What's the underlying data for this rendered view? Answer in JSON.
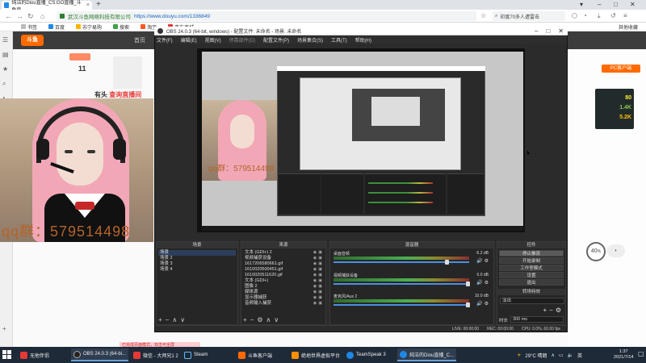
{
  "browser": {
    "tab_title": "纯洁的Diou直播_CS:GO直播_斗鱼直",
    "address_cert": "武汉斗鱼网络科技有限公司",
    "url": "https://www.douyu.com/1336849",
    "search_text": "印度70多人遭雷击",
    "bookmarks": [
      "书签",
      "百度",
      "苏宁易购",
      "搜索",
      "淘宝",
      "京东商城"
    ],
    "bookmarks_right": "其他收藏"
  },
  "douyu": {
    "logo_text": "斗鱼",
    "home_label": "首页",
    "sidebar_count": "11",
    "anchor_line_prefix": "有头",
    "anchor_line_text": "查询直播间",
    "right_label": "PC客户端",
    "gauge_value": "40",
    "gauge_unit": "%",
    "net_stats": [
      "80",
      "1.4K",
      "5.2K"
    ],
    "hint": "已完成页面模式，双击可全屏"
  },
  "webcam": {
    "qq_text": "qq群：579514498"
  },
  "obs": {
    "title": "OBS 24.0.3 (64-bit, windows) - 配置文件: 未命名 - 场景: 未命名",
    "menu": [
      "文件(F)",
      "编辑(E)",
      "视图(V)",
      "停靠部件(D)",
      "配置文件(P)",
      "场景集合(S)",
      "工具(T)",
      "帮助(H)"
    ],
    "preview_qq": "qq群：579514498",
    "docks": {
      "scenes": {
        "title": "场景",
        "items": [
          "场景",
          "场景 2",
          "场景 3",
          "场景 4"
        ]
      },
      "sources": {
        "title": "来源",
        "items": [
          "文本 (GDI+) 2",
          "视频捕获设备",
          "1617206580661.gif",
          "1610020500451.gif",
          "1610020511620.gif",
          "文本 (GDI+)",
          "图像 2",
          "媒体源",
          "显示器捕获",
          "音频输入捕获"
        ]
      },
      "mixer": {
        "title": "混音器",
        "channels": [
          {
            "name": "桌面音频",
            "db": "-5.2 dB"
          },
          {
            "name": "视频捕获设备",
            "db": "0.0 dB"
          },
          {
            "name": "麦克风/Aux 2",
            "db": "10.0 dB"
          }
        ]
      },
      "controls": {
        "title": "控件",
        "buttons": [
          "停止推流",
          "开始录制",
          "工作室模式",
          "设置",
          "退出"
        ],
        "transition_title": "转场特效",
        "transition_value": "淡出",
        "duration_label": "时长",
        "duration_value": "300 ms"
      }
    },
    "status": {
      "live": "LIVE: 00:00:00",
      "rec": "REC: 00:00:00",
      "cpu": "CPU: 0.0%, 60.00 fps"
    }
  },
  "taskbar": {
    "items": [
      {
        "label": "无他伴侣",
        "color": "#e53935"
      },
      {
        "label": "OBS 24.0.3 (64-bi...",
        "color": "#222222"
      },
      {
        "label": "微信 - 大师兄1 2",
        "color": "#e53935"
      },
      {
        "label": "Steam",
        "color": "#1b2838"
      },
      {
        "label": "斗鱼客户端",
        "color": "#ff6a00"
      },
      {
        "label": "绝地世界虚拟平台",
        "color": "#ff8f00"
      },
      {
        "label": "TeamSpeak 3",
        "color": "#1e88e5"
      },
      {
        "label": "纯洁的Diou直播_C...",
        "color": "#ff6a00"
      }
    ],
    "weather": "29°C 晴朗",
    "time": "1:37",
    "date": "2021/7/14"
  }
}
